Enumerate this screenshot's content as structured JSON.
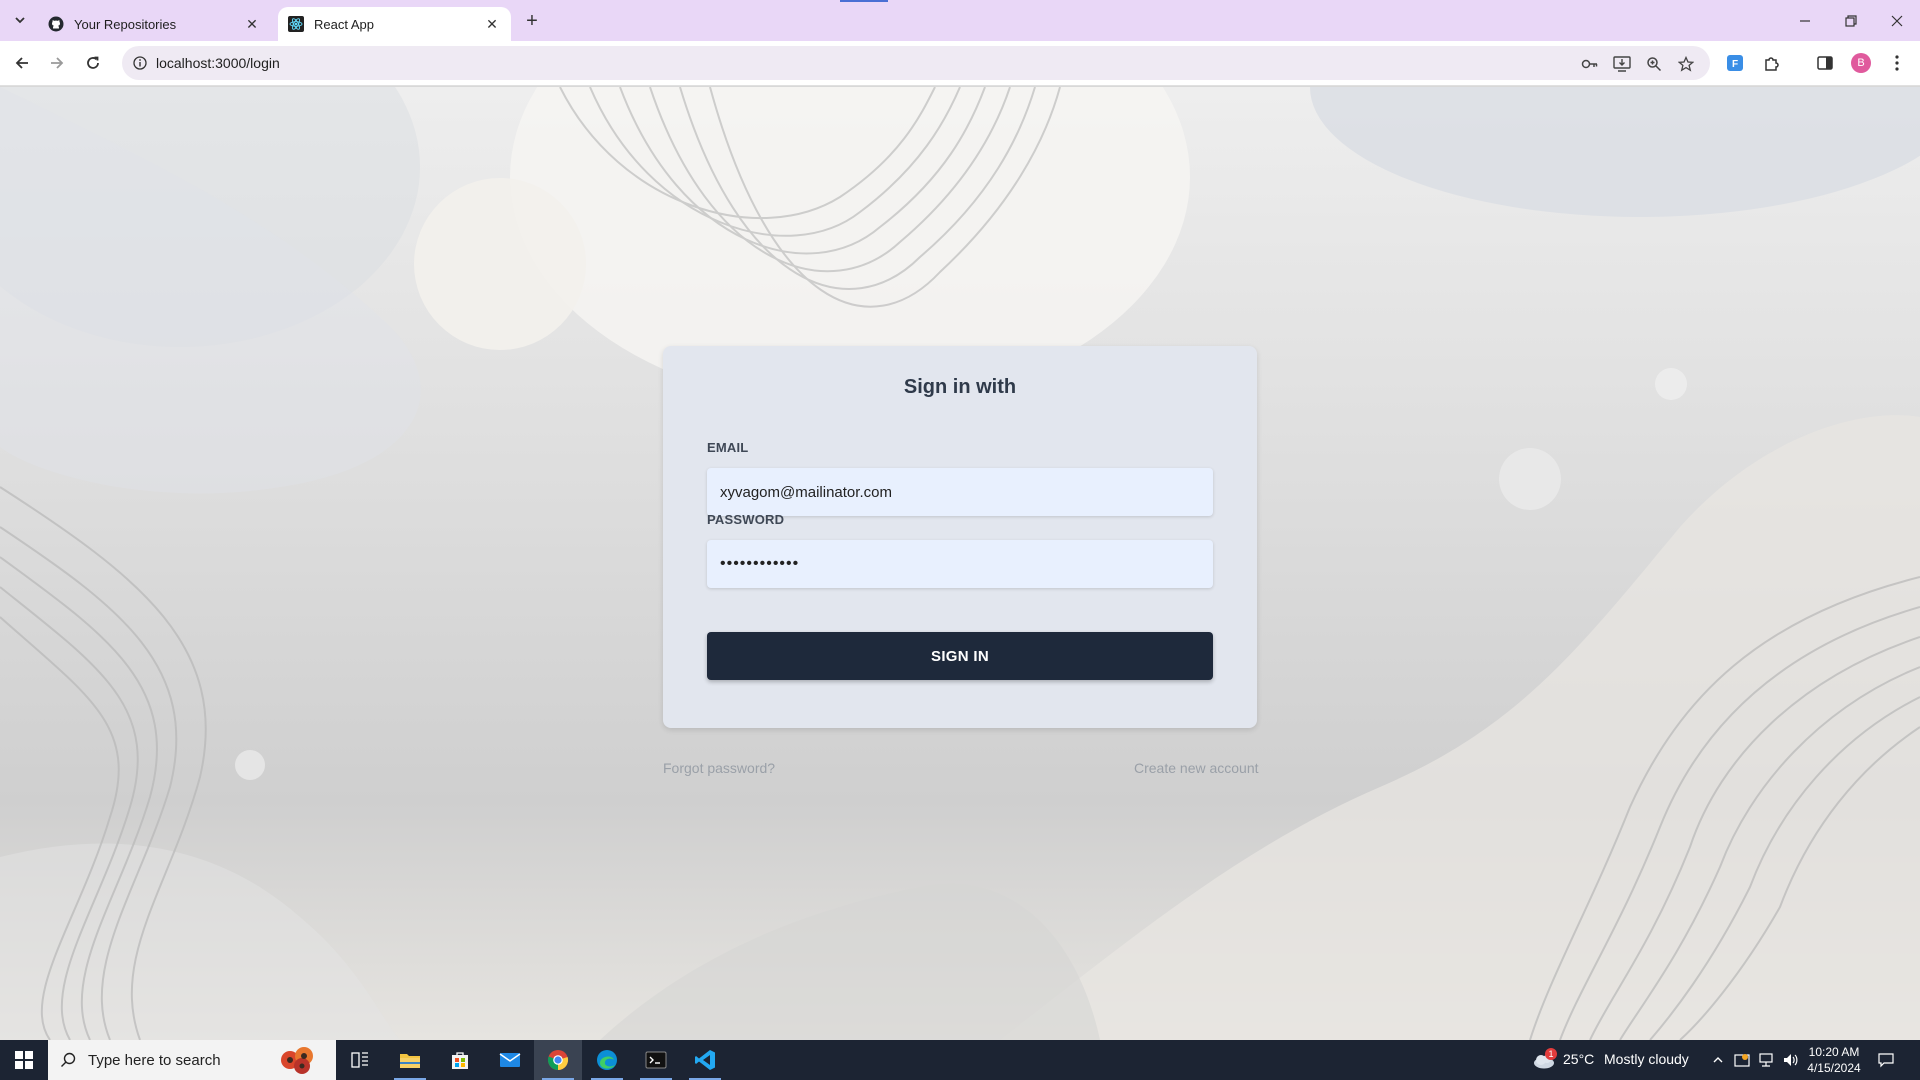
{
  "browser": {
    "tabs": [
      {
        "title": "Your Repositories",
        "favicon": "github-icon",
        "active": false
      },
      {
        "title": "React App",
        "favicon": "react-icon",
        "active": true
      }
    ],
    "url": "localhost:3000/login",
    "profile_initial": "B"
  },
  "login": {
    "title": "Sign in with",
    "email_label": "EMAIL",
    "email_value": "xyvagom@mailinator.com",
    "password_label": "PASSWORD",
    "password_value": "••••••••••••",
    "submit_label": "SIGN IN",
    "forgot_link": "Forgot password?",
    "create_link": "Create new account"
  },
  "taskbar": {
    "search_placeholder": "Type here to search",
    "weather_temp": "25°C",
    "weather_text": "Mostly cloudy",
    "weather_badge": "1",
    "time": "10:20 AM",
    "date": "4/15/2024"
  },
  "colors": {
    "tabstrip": "#e9d7f7",
    "card": "#e2e6ee",
    "button": "#1e293b",
    "taskbar": "#1c2433"
  }
}
